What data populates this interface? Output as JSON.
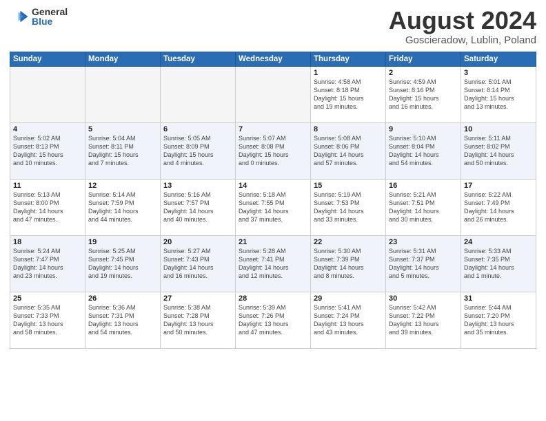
{
  "logo": {
    "general": "General",
    "blue": "Blue"
  },
  "calendar": {
    "title": "August 2024",
    "subtitle": "Goscieradow, Lublin, Poland"
  },
  "headers": [
    "Sunday",
    "Monday",
    "Tuesday",
    "Wednesday",
    "Thursday",
    "Friday",
    "Saturday"
  ],
  "weeks": [
    [
      {
        "day": "",
        "info": ""
      },
      {
        "day": "",
        "info": ""
      },
      {
        "day": "",
        "info": ""
      },
      {
        "day": "",
        "info": ""
      },
      {
        "day": "1",
        "info": "Sunrise: 4:58 AM\nSunset: 8:18 PM\nDaylight: 15 hours\nand 19 minutes."
      },
      {
        "day": "2",
        "info": "Sunrise: 4:59 AM\nSunset: 8:16 PM\nDaylight: 15 hours\nand 16 minutes."
      },
      {
        "day": "3",
        "info": "Sunrise: 5:01 AM\nSunset: 8:14 PM\nDaylight: 15 hours\nand 13 minutes."
      }
    ],
    [
      {
        "day": "4",
        "info": "Sunrise: 5:02 AM\nSunset: 8:13 PM\nDaylight: 15 hours\nand 10 minutes."
      },
      {
        "day": "5",
        "info": "Sunrise: 5:04 AM\nSunset: 8:11 PM\nDaylight: 15 hours\nand 7 minutes."
      },
      {
        "day": "6",
        "info": "Sunrise: 5:05 AM\nSunset: 8:09 PM\nDaylight: 15 hours\nand 4 minutes."
      },
      {
        "day": "7",
        "info": "Sunrise: 5:07 AM\nSunset: 8:08 PM\nDaylight: 15 hours\nand 0 minutes."
      },
      {
        "day": "8",
        "info": "Sunrise: 5:08 AM\nSunset: 8:06 PM\nDaylight: 14 hours\nand 57 minutes."
      },
      {
        "day": "9",
        "info": "Sunrise: 5:10 AM\nSunset: 8:04 PM\nDaylight: 14 hours\nand 54 minutes."
      },
      {
        "day": "10",
        "info": "Sunrise: 5:11 AM\nSunset: 8:02 PM\nDaylight: 14 hours\nand 50 minutes."
      }
    ],
    [
      {
        "day": "11",
        "info": "Sunrise: 5:13 AM\nSunset: 8:00 PM\nDaylight: 14 hours\nand 47 minutes."
      },
      {
        "day": "12",
        "info": "Sunrise: 5:14 AM\nSunset: 7:59 PM\nDaylight: 14 hours\nand 44 minutes."
      },
      {
        "day": "13",
        "info": "Sunrise: 5:16 AM\nSunset: 7:57 PM\nDaylight: 14 hours\nand 40 minutes."
      },
      {
        "day": "14",
        "info": "Sunrise: 5:18 AM\nSunset: 7:55 PM\nDaylight: 14 hours\nand 37 minutes."
      },
      {
        "day": "15",
        "info": "Sunrise: 5:19 AM\nSunset: 7:53 PM\nDaylight: 14 hours\nand 33 minutes."
      },
      {
        "day": "16",
        "info": "Sunrise: 5:21 AM\nSunset: 7:51 PM\nDaylight: 14 hours\nand 30 minutes."
      },
      {
        "day": "17",
        "info": "Sunrise: 5:22 AM\nSunset: 7:49 PM\nDaylight: 14 hours\nand 26 minutes."
      }
    ],
    [
      {
        "day": "18",
        "info": "Sunrise: 5:24 AM\nSunset: 7:47 PM\nDaylight: 14 hours\nand 23 minutes."
      },
      {
        "day": "19",
        "info": "Sunrise: 5:25 AM\nSunset: 7:45 PM\nDaylight: 14 hours\nand 19 minutes."
      },
      {
        "day": "20",
        "info": "Sunrise: 5:27 AM\nSunset: 7:43 PM\nDaylight: 14 hours\nand 16 minutes."
      },
      {
        "day": "21",
        "info": "Sunrise: 5:28 AM\nSunset: 7:41 PM\nDaylight: 14 hours\nand 12 minutes."
      },
      {
        "day": "22",
        "info": "Sunrise: 5:30 AM\nSunset: 7:39 PM\nDaylight: 14 hours\nand 8 minutes."
      },
      {
        "day": "23",
        "info": "Sunrise: 5:31 AM\nSunset: 7:37 PM\nDaylight: 14 hours\nand 5 minutes."
      },
      {
        "day": "24",
        "info": "Sunrise: 5:33 AM\nSunset: 7:35 PM\nDaylight: 14 hours\nand 1 minute."
      }
    ],
    [
      {
        "day": "25",
        "info": "Sunrise: 5:35 AM\nSunset: 7:33 PM\nDaylight: 13 hours\nand 58 minutes."
      },
      {
        "day": "26",
        "info": "Sunrise: 5:36 AM\nSunset: 7:31 PM\nDaylight: 13 hours\nand 54 minutes."
      },
      {
        "day": "27",
        "info": "Sunrise: 5:38 AM\nSunset: 7:28 PM\nDaylight: 13 hours\nand 50 minutes."
      },
      {
        "day": "28",
        "info": "Sunrise: 5:39 AM\nSunset: 7:26 PM\nDaylight: 13 hours\nand 47 minutes."
      },
      {
        "day": "29",
        "info": "Sunrise: 5:41 AM\nSunset: 7:24 PM\nDaylight: 13 hours\nand 43 minutes."
      },
      {
        "day": "30",
        "info": "Sunrise: 5:42 AM\nSunset: 7:22 PM\nDaylight: 13 hours\nand 39 minutes."
      },
      {
        "day": "31",
        "info": "Sunrise: 5:44 AM\nSunset: 7:20 PM\nDaylight: 13 hours\nand 35 minutes."
      }
    ]
  ]
}
